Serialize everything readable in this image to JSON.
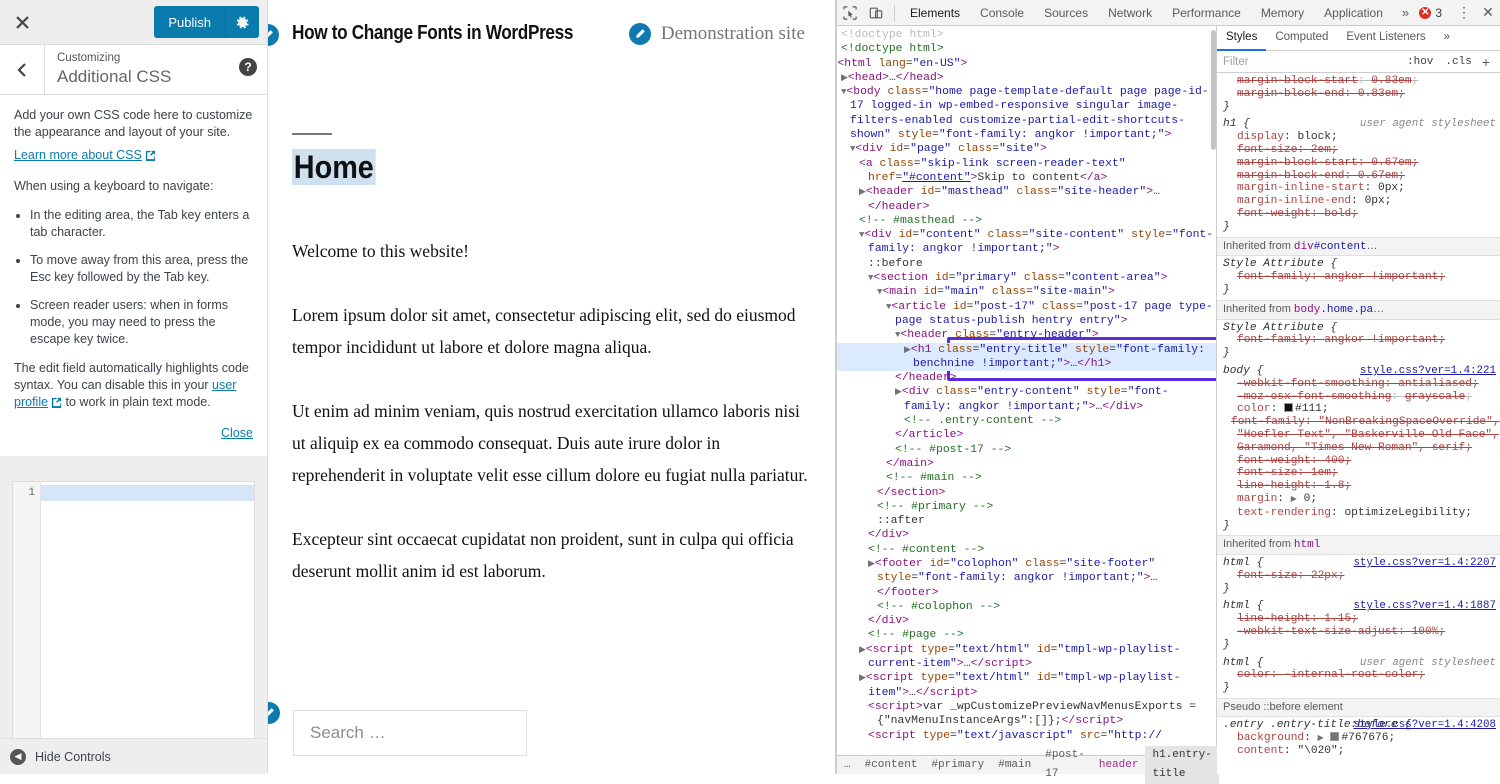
{
  "customizer": {
    "close_label": "✕",
    "publish_label": "Publish",
    "gear_icon": "gear-icon",
    "back_icon": "chevron-left-icon",
    "subtitle": "Customizing",
    "title": "Additional CSS",
    "help_label": "?",
    "desc_p1": "Add your own CSS code here to customize the appearance and layout of your site.",
    "learn_link": "Learn more about CSS",
    "desc_p2": "When using a keyboard to navigate:",
    "bullets": [
      "In the editing area, the Tab key enters a tab character.",
      "To move away from this area, press the Esc key followed by the Tab key.",
      "Screen reader users: when in forms mode, you may need to press the escape key twice."
    ],
    "desc_p3_a": "The edit field automatically highlights code syntax. You can disable this in your ",
    "desc_p3_link": "user profile",
    "desc_p3_b": " to work in plain text mode.",
    "close_text": "Close",
    "editor_line_number": "1",
    "editor_value": "",
    "hide_controls": "Hide Controls"
  },
  "preview": {
    "site_title": "How to Change Fonts in WordPress",
    "tagline": "Demonstration site",
    "page_title": "Home",
    "paragraphs": [
      "Welcome to this website!",
      "Lorem ipsum dolor sit amet, consectetur adipiscing elit, sed do eiusmod tempor incididunt ut labore et dolore magna aliqua.",
      "Ut enim ad minim veniam, quis nostrud exercitation ullamco laboris nisi ut aliquip ex ea commodo consequat. Duis aute irure dolor in reprehenderit in voluptate velit esse cillum dolore eu fugiat nulla pariatur.",
      "Excepteur sint occaecat cupidatat non proident, sunt in culpa qui officia deserunt mollit anim id est laborum."
    ],
    "search_placeholder": "Search …"
  },
  "devtools": {
    "inspect_icon": "inspect-element-icon",
    "device_icon": "device-toolbar-icon",
    "tabs": [
      {
        "label": "Elements",
        "active": true
      },
      {
        "label": "Console",
        "active": false
      },
      {
        "label": "Sources",
        "active": false
      },
      {
        "label": "Network",
        "active": false
      },
      {
        "label": "Performance",
        "active": false
      },
      {
        "label": "Memory",
        "active": false
      },
      {
        "label": "Application",
        "active": false
      }
    ],
    "more_tabs": "»",
    "error_count": "3",
    "kebab": "⋮",
    "close": "✕",
    "breadcrumbs": [
      {
        "label": "…",
        "pink": false,
        "selected": false
      },
      {
        "label": "#content",
        "pink": false,
        "selected": false
      },
      {
        "label": "#primary",
        "pink": false,
        "selected": false
      },
      {
        "label": "#main",
        "pink": false,
        "selected": false
      },
      {
        "label": "#post-17",
        "pink": false,
        "selected": false
      },
      {
        "label": "header",
        "pink": true,
        "selected": false
      },
      {
        "label": "h1.entry-title",
        "pink": false,
        "selected": true
      }
    ]
  },
  "dom": {
    "lines": [
      {
        "indent": 1,
        "html": "<span class=\"cmt dim\">&lt;!doctype html&gt;</span>"
      },
      {
        "indent": 1,
        "html": "<span class=\"cmt\">&lt;!doctype html&gt;</span>"
      },
      {
        "indent": 0,
        "html": "<span class=\"twirl\">▼</span><span class=\"tag\">&lt;html</span> <span class=\"attr\">lang</span>=<span class=\"val\">\"en-US\"</span><span class=\"tag\">&gt;</span>"
      },
      {
        "indent": 1,
        "html": "<span class=\"twirl\">▶</span><span class=\"tag\">&lt;head&gt;</span><span class=\"txt\">…</span><span class=\"tag\">&lt;/head&gt;</span>"
      },
      {
        "indent": 1,
        "html": "<span class=\"twirl\">▼</span><span class=\"tag\">&lt;body</span> <span class=\"attr\">class</span>=<span class=\"val\">\"home page-template-default page page-id-17 logged-in wp-embed-responsive singular image-filters-enabled customize-partial-edit-shortcuts-shown\"</span> <span class=\"attr\">style</span>=<span class=\"val\">\"font-family: angkor !important;\"</span><span class=\"tag\">&gt;</span>"
      },
      {
        "indent": 2,
        "html": "<span class=\"twirl\">▼</span><span class=\"tag\">&lt;div</span> <span class=\"attr\">id</span>=<span class=\"val\">\"page\"</span> <span class=\"attr\">class</span>=<span class=\"val\">\"site\"</span><span class=\"tag\">&gt;</span>"
      },
      {
        "indent": 3,
        "html": "<span class=\"tag\">&lt;a</span> <span class=\"attr\">class</span>=<span class=\"val\">\"skip-link screen-reader-text\"</span> <span class=\"attr\">href</span>=<span class=\"val link\">\"#content\"</span><span class=\"tag\">&gt;</span><span class=\"txt\">Skip to content</span><span class=\"tag\">&lt;/a&gt;</span>"
      },
      {
        "indent": 3,
        "html": "<span class=\"twirl\">▶</span><span class=\"tag\">&lt;header</span> <span class=\"attr\">id</span>=<span class=\"val\">\"masthead\"</span> <span class=\"attr\">class</span>=<span class=\"val\">\"site-header\"</span><span class=\"tag\">&gt;</span><span class=\"txt\">…</span><span class=\"tag\">&lt;/header&gt;</span>"
      },
      {
        "indent": 3,
        "html": "<span class=\"cmt\">&lt;!-- #masthead --&gt;</span>"
      },
      {
        "indent": 3,
        "html": "<span class=\"twirl\">▼</span><span class=\"tag\">&lt;div</span> <span class=\"attr\">id</span>=<span class=\"val\">\"content\"</span> <span class=\"attr\">class</span>=<span class=\"val\">\"site-content\"</span> <span class=\"attr\">style</span>=<span class=\"val\">\"font-family: angkor !important;\"</span><span class=\"tag\">&gt;</span>"
      },
      {
        "indent": 4,
        "html": "<span class=\"txt\">::before</span>"
      },
      {
        "indent": 4,
        "html": "<span class=\"twirl\">▼</span><span class=\"tag\">&lt;section</span> <span class=\"attr\">id</span>=<span class=\"val\">\"primary\"</span> <span class=\"attr\">class</span>=<span class=\"val\">\"content-area\"</span><span class=\"tag\">&gt;</span>"
      },
      {
        "indent": 5,
        "html": "<span class=\"twirl\">▼</span><span class=\"tag\">&lt;main</span> <span class=\"attr\">id</span>=<span class=\"val\">\"main\"</span> <span class=\"attr\">class</span>=<span class=\"val\">\"site-main\"</span><span class=\"tag\">&gt;</span>"
      },
      {
        "indent": 6,
        "html": "<span class=\"twirl\">▼</span><span class=\"tag\">&lt;article</span> <span class=\"attr\">id</span>=<span class=\"val\">\"post-17\"</span> <span class=\"attr\">class</span>=<span class=\"val\">\"post-17 page type-page status-publish hentry entry\"</span><span class=\"tag\">&gt;</span>"
      },
      {
        "indent": 7,
        "html": "<span class=\"twirl\">▼</span><span class=\"tag\">&lt;header</span> <span class=\"attr\">class</span>=<span class=\"val\">\"entry-header\"</span><span class=\"tag\">&gt;</span>"
      },
      {
        "indent": 8,
        "sel": true,
        "html": "<span class=\"twirl\">▶</span><span class=\"tag\">&lt;h1</span> <span class=\"attr\">class</span>=<span class=\"val\">\"entry-title\"</span> <span class=\"attr\">style</span>=<span class=\"val\">\"font-family: benchnine !important;\"</span><span class=\"tag\">&gt;</span><span class=\"txt\">…</span><span class=\"tag\">&lt;/h1&gt;</span>"
      },
      {
        "indent": 7,
        "html": "<span class=\"tag\">&lt;/header&gt;</span>"
      },
      {
        "indent": 7,
        "html": "<span class=\"twirl\">▶</span><span class=\"tag\">&lt;div</span> <span class=\"attr\">class</span>=<span class=\"val\">\"entry-content\"</span> <span class=\"attr\">style</span>=<span class=\"val\">\"font-family: angkor !important;\"</span><span class=\"tag\">&gt;</span><span class=\"txt\">…</span><span class=\"tag\">&lt;/div&gt;</span>"
      },
      {
        "indent": 8,
        "html": "<span class=\"cmt\">&lt;!-- .entry-content --&gt;</span>"
      },
      {
        "indent": 7,
        "html": "<span class=\"tag\">&lt;/article&gt;</span>"
      },
      {
        "indent": 7,
        "html": "<span class=\"cmt\">&lt;!-- #post-17 --&gt;</span>"
      },
      {
        "indent": 6,
        "html": "<span class=\"tag\">&lt;/main&gt;</span>"
      },
      {
        "indent": 6,
        "html": "<span class=\"cmt\">&lt;!-- #main --&gt;</span>"
      },
      {
        "indent": 5,
        "html": "<span class=\"tag\">&lt;/section&gt;</span>"
      },
      {
        "indent": 5,
        "html": "<span class=\"cmt\">&lt;!-- #primary --&gt;</span>"
      },
      {
        "indent": 5,
        "html": "<span class=\"txt\">::after</span>"
      },
      {
        "indent": 4,
        "html": "<span class=\"tag\">&lt;/div&gt;</span>"
      },
      {
        "indent": 4,
        "html": "<span class=\"cmt\">&lt;!-- #content --&gt;</span>"
      },
      {
        "indent": 4,
        "html": "<span class=\"twirl\">▶</span><span class=\"tag\">&lt;footer</span> <span class=\"attr\">id</span>=<span class=\"val\">\"colophon\"</span> <span class=\"attr\">class</span>=<span class=\"val\">\"site-footer\"</span> <span class=\"attr\">style</span>=<span class=\"val\">\"font-family: angkor !important;\"</span><span class=\"tag\">&gt;</span><span class=\"txt\">…</span><span class=\"tag\">&lt;/footer&gt;</span>"
      },
      {
        "indent": 5,
        "html": "<span class=\"cmt\">&lt;!-- #colophon --&gt;</span>"
      },
      {
        "indent": 4,
        "html": "<span class=\"tag\">&lt;/div&gt;</span>"
      },
      {
        "indent": 4,
        "html": "<span class=\"cmt\">&lt;!-- #page --&gt;</span>"
      },
      {
        "indent": 3,
        "html": "<span class=\"twirl\">▶</span><span class=\"tag\">&lt;script</span> <span class=\"attr\">type</span>=<span class=\"val\">\"text/html\"</span> <span class=\"attr\">id</span>=<span class=\"val\">\"tmpl-wp-playlist-current-item\"</span><span class=\"tag\">&gt;</span><span class=\"txt\">…</span><span class=\"tag\">&lt;/script&gt;</span>"
      },
      {
        "indent": 3,
        "html": "<span class=\"twirl\">▶</span><span class=\"tag\">&lt;script</span> <span class=\"attr\">type</span>=<span class=\"val\">\"text/html\"</span> <span class=\"attr\">id</span>=<span class=\"val\">\"tmpl-wp-playlist-item\"</span><span class=\"tag\">&gt;</span><span class=\"txt\">…</span><span class=\"tag\">&lt;/script&gt;</span>"
      },
      {
        "indent": 4,
        "html": "<span class=\"tag\">&lt;script&gt;</span><span class=\"txt\">var _wpCustomizePreviewNavMenusExports = {\"navMenuInstanceArgs\":[]};</span><span class=\"tag\">&lt;/script&gt;</span>"
      },
      {
        "indent": 4,
        "html": "<span class=\"tag\">&lt;script</span> <span class=\"attr\">type</span>=<span class=\"val\">\"text/javascript\"</span> <span class=\"attr\">src</span>=<span class=\"val\">\"http://</span>"
      }
    ]
  },
  "styles": {
    "tabs": [
      {
        "label": "Styles",
        "active": true
      },
      {
        "label": "Computed",
        "active": false
      },
      {
        "label": "Event Listeners",
        "active": false
      }
    ],
    "more": "»",
    "filter_placeholder": "Filter",
    "hov_label": ":hov",
    "cls_label": ".cls",
    "plus_label": "+",
    "rules": [
      {
        "type": "rule",
        "partial_top": true,
        "selector": "",
        "origin": "",
        "declarations": [
          {
            "name": "margin-block-start",
            "value": "0.83em",
            "strike": true,
            "faded": true
          },
          {
            "name": "margin-block-end",
            "value": "0.83em",
            "strike": true
          }
        ],
        "close": "}"
      },
      {
        "type": "rule",
        "selector": "h1 {",
        "origin": "user agent stylesheet",
        "origin_link": false,
        "declarations": [
          {
            "name": "display",
            "value": "block",
            "strike": false
          },
          {
            "name": "font-size",
            "value": "2em",
            "strike": true
          },
          {
            "name": "margin-block-start",
            "value": "0.67em",
            "strike": true
          },
          {
            "name": "margin-block-end",
            "value": "0.67em",
            "strike": true
          },
          {
            "name": "margin-inline-start",
            "value": "0px",
            "strike": false
          },
          {
            "name": "margin-inline-end",
            "value": "0px",
            "strike": false
          },
          {
            "name": "font-weight",
            "value": "bold",
            "strike": true
          }
        ],
        "close": "}"
      },
      {
        "type": "inherit",
        "prefix": "Inherited from ",
        "tag": "div",
        "id": "#content",
        "suffix": "…"
      },
      {
        "type": "rule",
        "selector": "Style Attribute {",
        "origin": "",
        "declarations": [
          {
            "name": "font-family",
            "value": "angkor !important",
            "strike": true
          }
        ],
        "close": "}"
      },
      {
        "type": "inherit",
        "prefix": "Inherited from ",
        "tag": "body",
        "id": ".home.pa",
        "suffix": "…"
      },
      {
        "type": "rule",
        "selector": "Style Attribute {",
        "origin": "",
        "declarations": [
          {
            "name": "font-family",
            "value": "angkor !important",
            "strike": true
          }
        ],
        "close": "}"
      },
      {
        "type": "rule",
        "selector": "body {",
        "origin": "style.css?ver=1.4:221",
        "origin_link": true,
        "declarations": [
          {
            "name": "-webkit-font-smoothing",
            "value": "antialiased",
            "strike": true
          },
          {
            "name": "-moz-osx-font-smoothing",
            "value": "grayscale",
            "strike": true,
            "faded": true
          },
          {
            "name": "color",
            "value": "#111",
            "strike": false,
            "swatch": "#111111"
          },
          {
            "name": "font-family",
            "value": "\"NonBreakingSpaceOverride\", \"Hoefler Text\", \"Baskerville Old Face\", Garamond, \"Times New Roman\", serif",
            "strike": true,
            "wrap": true
          },
          {
            "name": "font-weight",
            "value": "400",
            "strike": true
          },
          {
            "name": "font-size",
            "value": "1em",
            "strike": true
          },
          {
            "name": "line-height",
            "value": "1.8",
            "strike": true
          },
          {
            "name": "margin",
            "value": "0",
            "strike": false,
            "faded": true,
            "expand": true
          },
          {
            "name": "text-rendering",
            "value": "optimizeLegibility",
            "strike": false
          }
        ],
        "close": "}"
      },
      {
        "type": "inherit",
        "prefix": "Inherited from ",
        "tag": "html",
        "id": "",
        "suffix": ""
      },
      {
        "type": "rule",
        "selector": "html {",
        "origin": "style.css?ver=1.4:2207",
        "origin_link": true,
        "declarations": [
          {
            "name": "font-size",
            "value": "22px",
            "strike": true
          }
        ],
        "close": "}"
      },
      {
        "type": "rule",
        "selector": "html {",
        "origin": "style.css?ver=1.4:1887",
        "origin_link": true,
        "declarations": [
          {
            "name": "line-height",
            "value": "1.15",
            "strike": true
          },
          {
            "name": "-webkit-text-size-adjust",
            "value": "100%",
            "strike": true
          }
        ],
        "close": "}"
      },
      {
        "type": "rule",
        "selector": "html {",
        "origin": "user agent stylesheet",
        "origin_link": false,
        "declarations": [
          {
            "name": "color",
            "value": "-internal-root-color",
            "strike": true
          }
        ],
        "close": "}"
      },
      {
        "type": "inherit",
        "prefix": "Pseudo ::before element",
        "tag": "",
        "id": "",
        "suffix": ""
      },
      {
        "type": "rule",
        "selector": ".entry .entry-title:before {",
        "selector_wrap": true,
        "origin": "style.css?ver=1.4:4208",
        "origin_link": true,
        "declarations": [
          {
            "name": "background",
            "value": "#767676",
            "strike": false,
            "swatch": "#767676",
            "expand": true
          },
          {
            "name": "content",
            "value": "\"\\020\"",
            "strike": false
          }
        ],
        "close": ""
      }
    ]
  }
}
